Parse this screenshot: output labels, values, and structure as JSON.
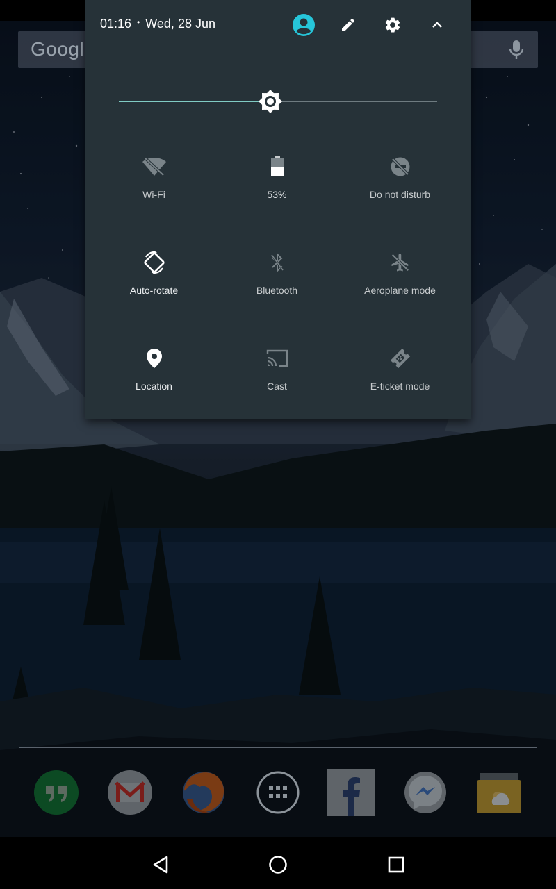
{
  "search": {
    "logo_text": "Google"
  },
  "quick_settings": {
    "time": "01:16",
    "separator": "•",
    "date": "Wed, 28 Jun",
    "brightness_level": 0.477,
    "accent_color": "#80cbc4",
    "tiles": [
      {
        "label": "Wi-Fi",
        "icon": "wifi-off-icon"
      },
      {
        "label": "53%",
        "icon": "battery-icon"
      },
      {
        "label": "Do not disturb",
        "icon": "do-not-disturb-icon"
      },
      {
        "label": "Auto-rotate",
        "icon": "auto-rotate-icon"
      },
      {
        "label": "Bluetooth",
        "icon": "bluetooth-icon"
      },
      {
        "label": "Aeroplane mode",
        "icon": "airplane-icon"
      },
      {
        "label": "Location",
        "icon": "location-pin-icon"
      },
      {
        "label": "Cast",
        "icon": "cast-icon"
      },
      {
        "label": "E-ticket mode",
        "icon": "eticket-icon"
      }
    ]
  },
  "dock": {
    "apps": [
      "Hangouts",
      "Gmail",
      "Firefox",
      "App drawer",
      "Facebook",
      "Messenger",
      "Weather"
    ]
  }
}
